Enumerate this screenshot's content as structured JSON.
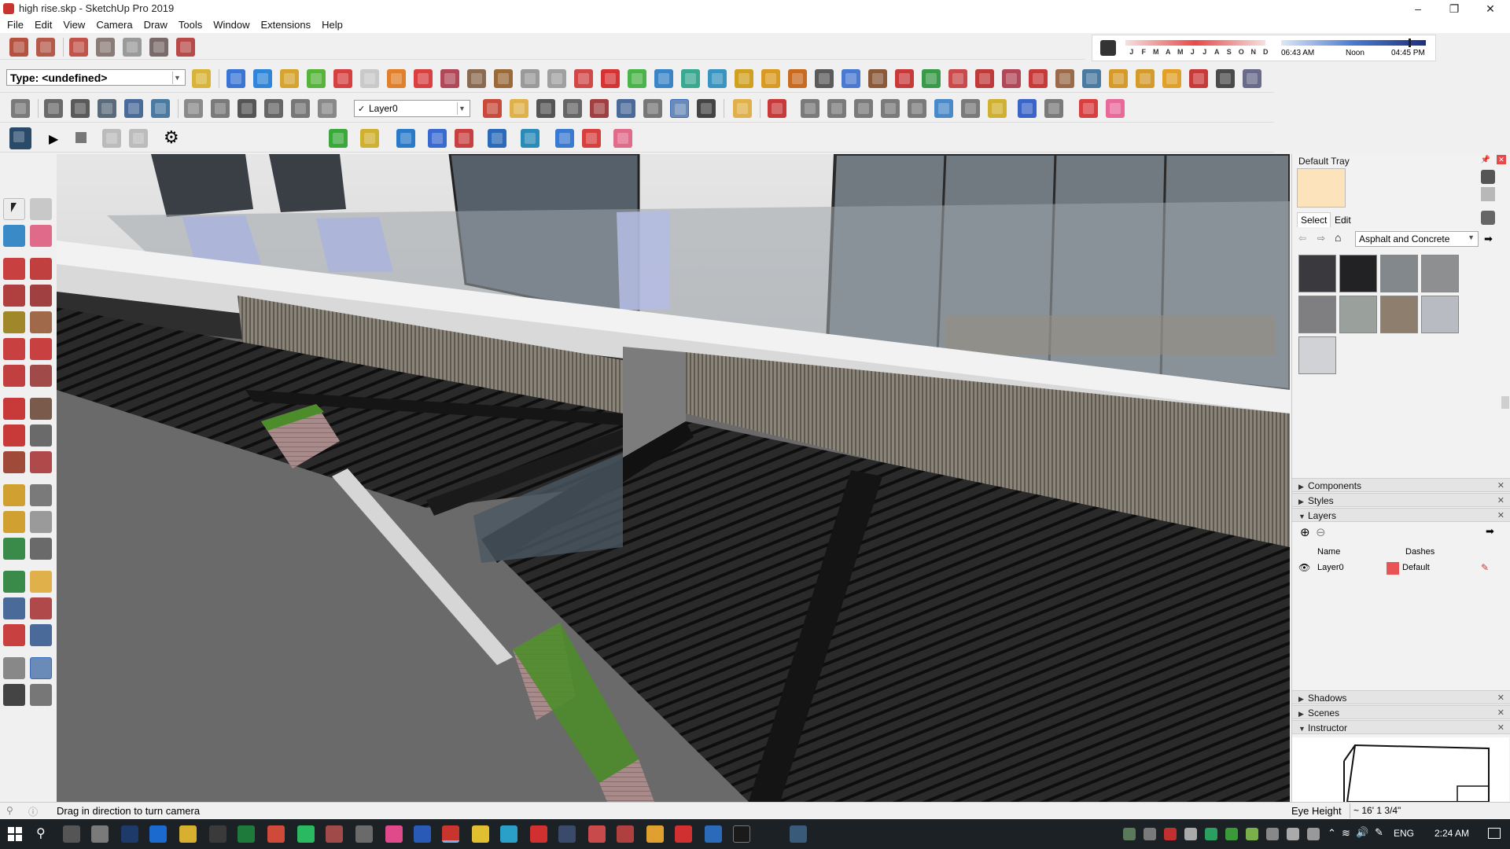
{
  "window": {
    "title": "high rise.skp - SketchUp Pro 2019",
    "controls": [
      "minimize",
      "maximize",
      "close"
    ]
  },
  "menu": [
    "File",
    "Edit",
    "View",
    "Camera",
    "Draw",
    "Tools",
    "Window",
    "Extensions",
    "Help"
  ],
  "toolbar": {
    "type_select": "Type: <undefined>",
    "layer_select": "Layer0",
    "layer_check": "✓"
  },
  "shadow_bar": {
    "months": [
      "J",
      "F",
      "M",
      "A",
      "M",
      "J",
      "J",
      "A",
      "S",
      "O",
      "N",
      "D"
    ],
    "time_start": "06:43 AM",
    "time_mid": "Noon",
    "time_end": "04:45 PM",
    "time_level": 0.88
  },
  "tray": {
    "title": "Default Tray",
    "tabs": {
      "select": "Select",
      "edit": "Edit"
    },
    "library": "Asphalt and Concrete",
    "swatch_colors": [
      "#3a3a3e",
      "#222224",
      "#83888c",
      "#8d8f90",
      "#7f7f82",
      "#9aa09c",
      "#8e7e6e",
      "#b8bcc2",
      "#d0d2d6"
    ],
    "panels_top": [
      "Components",
      "Styles",
      "Layers"
    ],
    "layers_columns": {
      "name": "Name",
      "dashes": "Dashes"
    },
    "layer_row": {
      "name": "Layer0",
      "dashes": "Default",
      "color": "#e85454"
    },
    "panels_bottom": [
      "Shadows",
      "Scenes",
      "Instructor"
    ]
  },
  "status": {
    "message": "Drag in direction to turn camera",
    "measure_label": "Eye Height",
    "measure_value": "~ 16' 1 3/4\""
  },
  "taskbar": {
    "language": "ENG",
    "clock": "2:24 AM"
  },
  "colors": {
    "accent": "#3a7ac8",
    "taskbar": "#1c2126"
  }
}
